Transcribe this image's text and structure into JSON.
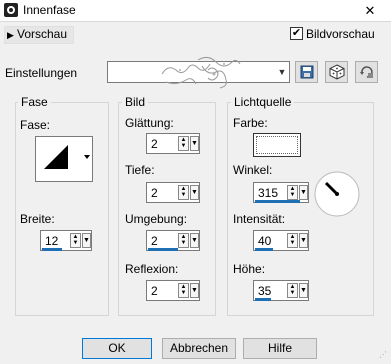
{
  "window": {
    "title": "Innenfase",
    "icon": "app-icon",
    "close_glyph": "✕"
  },
  "preview": {
    "toggle_label": "Vorschau",
    "bildvorschau_label": "Bildvorschau",
    "bildvorschau_checked": true
  },
  "settings": {
    "label": "Einstellungen",
    "value": "",
    "buttons": [
      "save-icon",
      "dice-icon",
      "reset-icon"
    ]
  },
  "fase_group": {
    "title": "Fase",
    "fase_label": "Fase:",
    "breite_label": "Breite:",
    "breite_value": "12"
  },
  "bild_group": {
    "title": "Bild",
    "glaettung_label": "Glättung:",
    "glaettung_value": "2",
    "tiefe_label": "Tiefe:",
    "tiefe_value": "2",
    "umgebung_label": "Umgebung:",
    "umgebung_value": "2",
    "reflexion_label": "Reflexion:",
    "reflexion_value": "2"
  },
  "licht_group": {
    "title": "Lichtquelle",
    "farbe_label": "Farbe:",
    "farbe_color": "#ffffff",
    "winkel_label": "Winkel:",
    "winkel_value": "315",
    "intensitaet_label": "Intensität:",
    "intensitaet_value": "40",
    "hoehe_label": "Höhe:",
    "hoehe_value": "35"
  },
  "buttons": {
    "ok": "OK",
    "abbrechen": "Abbrechen",
    "hilfe": "Hilfe"
  },
  "accent_color": "#0078d7",
  "slider_color": "#1f6fb4"
}
